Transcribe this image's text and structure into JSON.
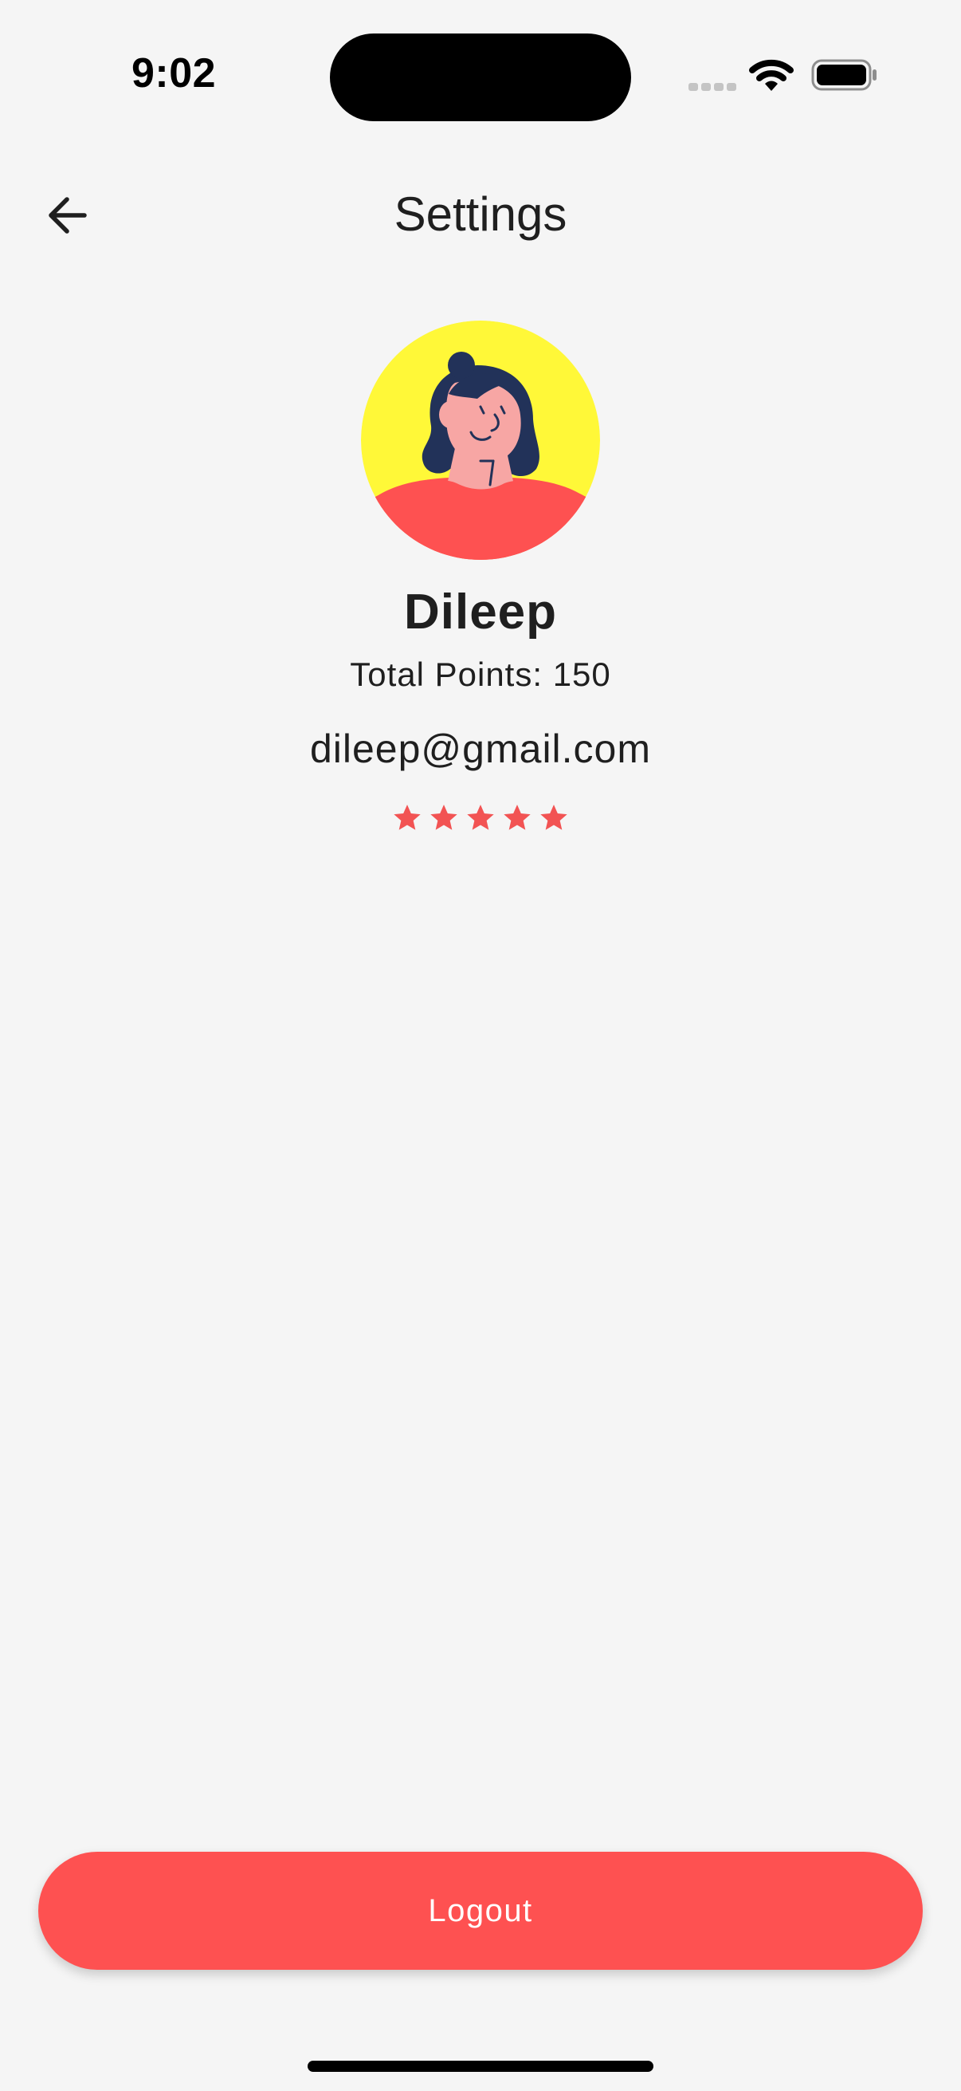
{
  "status_bar": {
    "time": "9:02"
  },
  "header": {
    "title": "Settings"
  },
  "profile": {
    "name": "Dileep",
    "points": "Total Points: 150",
    "email": "dileep@gmail.com",
    "rating": 5,
    "rating_max": 5,
    "rating_color": "#f25353"
  },
  "actions": {
    "logout_label": "Logout",
    "logout_color": "#fe5151"
  },
  "icons": {
    "back": "arrow-left-icon",
    "signal": "cellular-signal-icon",
    "wifi": "wifi-icon",
    "battery": "battery-icon",
    "star": "star-icon"
  }
}
